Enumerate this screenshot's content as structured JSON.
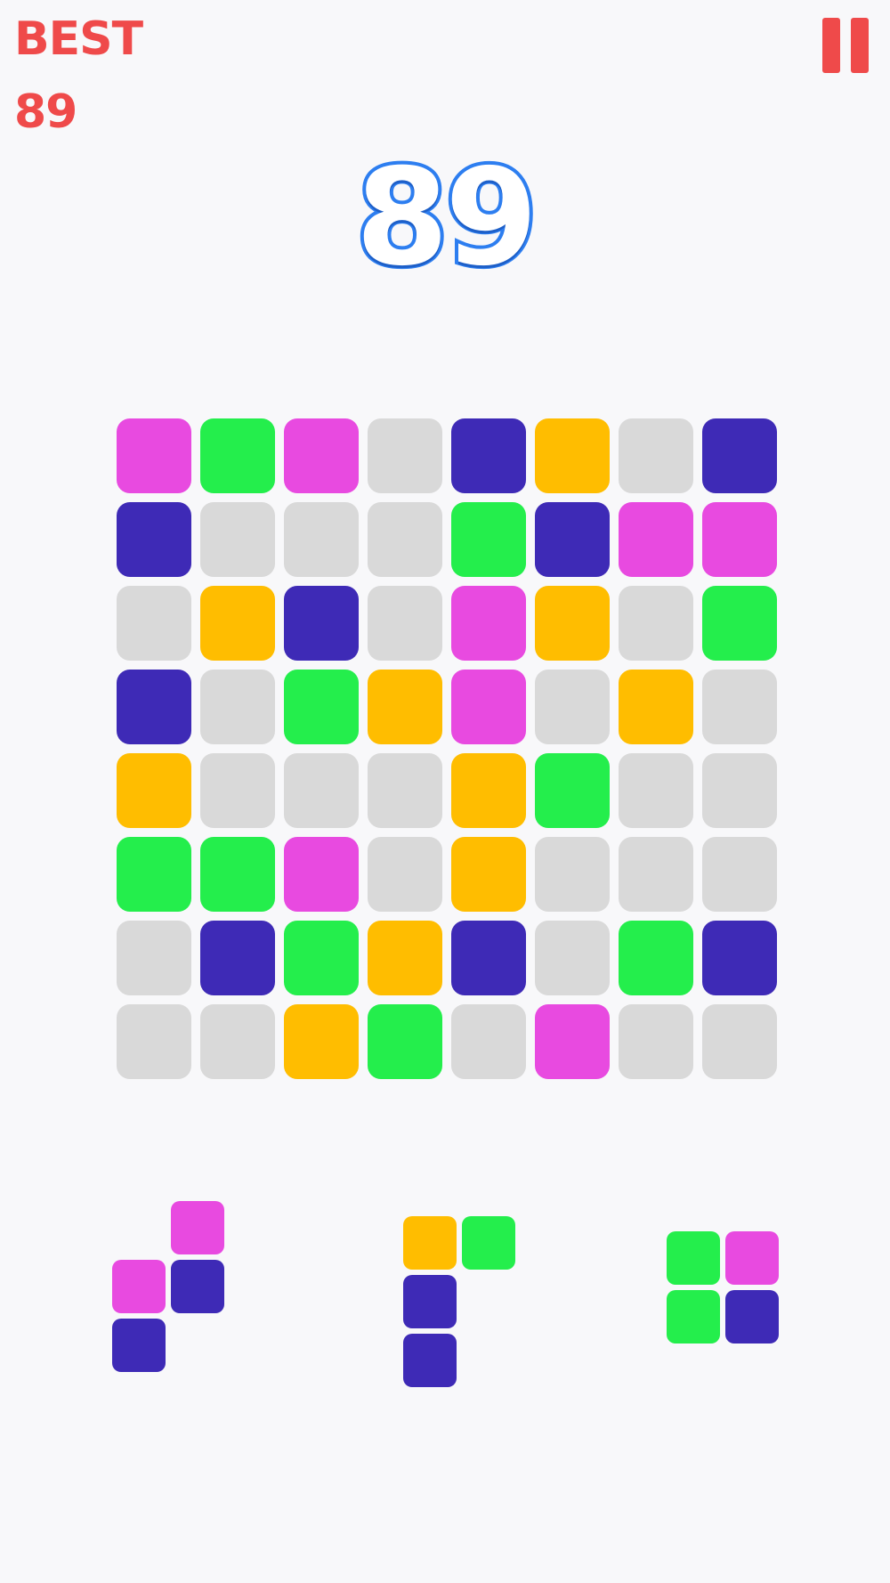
{
  "header": {
    "best_label": "BEST",
    "best_value": "89",
    "score": "89",
    "pause_icon": "pause-icon"
  },
  "colors": {
    "empty": "#d9d9d9",
    "M": "#e84ae0",
    "G": "#24ee4c",
    "N": "#3e2ab6",
    "Y": "#ffbd00",
    "accent_red": "#ef4a4a",
    "score_blue": "#2d7ef0",
    "background": "#f8f8fa"
  },
  "board": {
    "rows": [
      [
        "M",
        "G",
        "M",
        "E",
        "N",
        "Y",
        "E",
        "N"
      ],
      [
        "N",
        "E",
        "E",
        "E",
        "G",
        "N",
        "M",
        "M"
      ],
      [
        "E",
        "Y",
        "N",
        "E",
        "M",
        "Y",
        "E",
        "G"
      ],
      [
        "N",
        "E",
        "G",
        "Y",
        "M",
        "E",
        "Y",
        "E"
      ],
      [
        "Y",
        "E",
        "E",
        "E",
        "Y",
        "G",
        "E",
        "E"
      ],
      [
        "G",
        "G",
        "M",
        "E",
        "Y",
        "E",
        "E",
        "E"
      ],
      [
        "E",
        "N",
        "G",
        "Y",
        "N",
        "E",
        "G",
        "N"
      ],
      [
        "E",
        "E",
        "Y",
        "G",
        "E",
        "M",
        "E",
        "E"
      ]
    ]
  },
  "pieces": [
    {
      "name": "piece-1",
      "cells": [
        [
          0,
          1,
          "M"
        ],
        [
          1,
          0,
          "M"
        ],
        [
          1,
          1,
          "N"
        ],
        [
          2,
          0,
          "N"
        ]
      ]
    },
    {
      "name": "piece-2",
      "cells": [
        [
          0,
          0,
          "Y"
        ],
        [
          0,
          1,
          "G"
        ],
        [
          1,
          0,
          "N"
        ],
        [
          2,
          0,
          "N"
        ]
      ]
    },
    {
      "name": "piece-3",
      "cells": [
        [
          0,
          0,
          "G"
        ],
        [
          0,
          1,
          "M"
        ],
        [
          1,
          0,
          "G"
        ],
        [
          1,
          1,
          "N"
        ]
      ]
    }
  ]
}
